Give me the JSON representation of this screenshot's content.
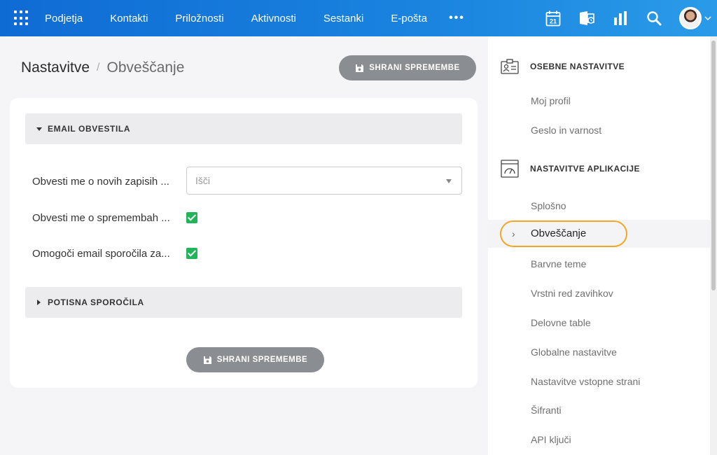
{
  "nav": {
    "items": [
      "Podjetja",
      "Kontakti",
      "Priložnosti",
      "Aktivnosti",
      "Sestanki",
      "E-pošta"
    ],
    "more": "•••",
    "calendar_day": "21"
  },
  "header": {
    "breadcrumb_root": "Nastavitve",
    "breadcrumb_current": "Obveščanje",
    "save_label": "SHRANI SPREMEMBE"
  },
  "sections": {
    "email": {
      "title": "EMAIL OBVESTILA",
      "rows": [
        {
          "label": "Obvesti me o novih zapisih ...",
          "placeholder": "Išči"
        },
        {
          "label": "Obvesti me o spremembah ..."
        },
        {
          "label": "Omogoči email sporočila za..."
        }
      ]
    },
    "push": {
      "title": "POTISNA SPOROČILA"
    }
  },
  "sidebar": {
    "personal": {
      "title": "OSEBNE NASTAVITVE",
      "items": [
        "Moj profil",
        "Geslo in varnost"
      ]
    },
    "app": {
      "title": "NASTAVITVE APLIKACIJE",
      "items": [
        "Splošno",
        "Obveščanje",
        "Barvne teme",
        "Vrstni red zavihkov",
        "Delovne table",
        "Globalne nastavitve",
        "Nastavitve vstopne strani",
        "Šifranti",
        "API ključi"
      ]
    }
  },
  "colors": {
    "accent": "#1a84df",
    "check": "#22b45a",
    "highlight": "#f0a826"
  }
}
